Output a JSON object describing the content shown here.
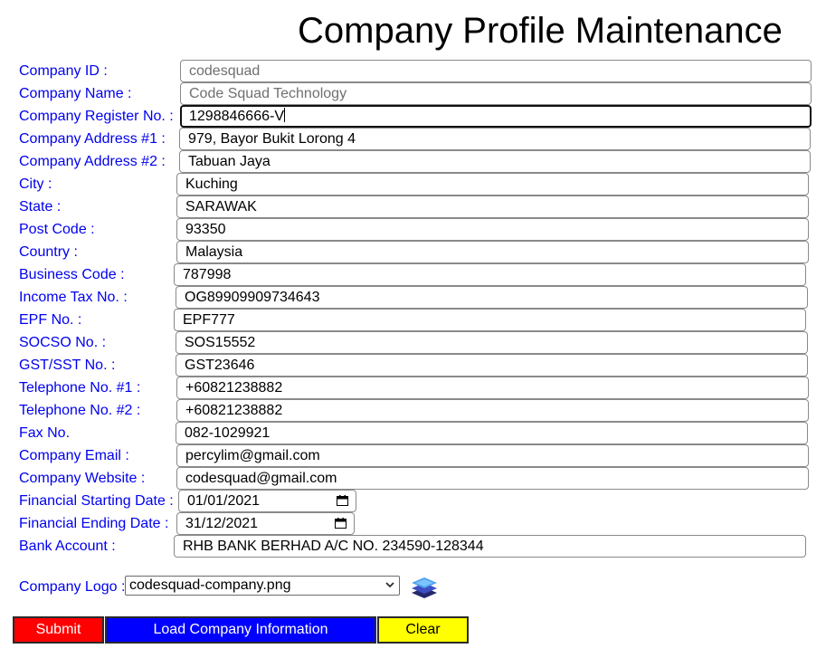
{
  "page": {
    "title": "Company Profile Maintenance"
  },
  "fields": [
    {
      "label": "Company ID :",
      "value": "codesquad"
    },
    {
      "label": "Company Name :",
      "value": "Code Squad Technology"
    },
    {
      "label": "Company Register No. :",
      "value": "1298846666-V"
    },
    {
      "label": "Company Address #1 :",
      "value": "979, Bayor Bukit Lorong 4"
    },
    {
      "label": "Company Address #2 :",
      "value": "Tabuan Jaya"
    },
    {
      "label": "City :",
      "value": "Kuching"
    },
    {
      "label": "State :",
      "value": "SARAWAK"
    },
    {
      "label": "Post Code :",
      "value": "93350"
    },
    {
      "label": "Country :",
      "value": "Malaysia"
    },
    {
      "label": "Business Code :",
      "value": "787998"
    },
    {
      "label": "Income Tax No. :",
      "value": "OG89909909734643"
    },
    {
      "label": "EPF No. :",
      "value": "EPF777"
    },
    {
      "label": "SOCSO No. :",
      "value": "SOS15552"
    },
    {
      "label": "GST/SST No. :",
      "value": "GST23646"
    },
    {
      "label": "Telephone No. #1 :",
      "value": "+60821238882"
    },
    {
      "label": "Telephone No. #2 :",
      "value": "+60821238882"
    },
    {
      "label": "Fax No.",
      "value": "082-1029921"
    },
    {
      "label": "Company Email :",
      "value": "percylim@gmail.com"
    },
    {
      "label": "Company Website :",
      "value": "codesquad@gmail.com"
    },
    {
      "label": "Financial Starting Date :",
      "value": "01/01/2021"
    },
    {
      "label": "Financial Ending Date :",
      "value": "31/12/2021"
    },
    {
      "label": "Bank Account :",
      "value": "RHB BANK BERHAD A/C NO. 234590-128344"
    }
  ],
  "logo": {
    "label": "Company Logo :",
    "selected": "codesquad-company.png"
  },
  "buttons": {
    "submit": "Submit",
    "load": "Load Company Information",
    "clear": "Clear"
  },
  "icons": {
    "calendar": "calendar-icon",
    "select_arrow": "chevron-down-icon",
    "logo_preview": "layers-icon"
  },
  "colors": {
    "label": "#0000ee",
    "submit_bg": "#ff0000",
    "load_bg": "#0000ff",
    "clear_bg": "#ffff00"
  }
}
